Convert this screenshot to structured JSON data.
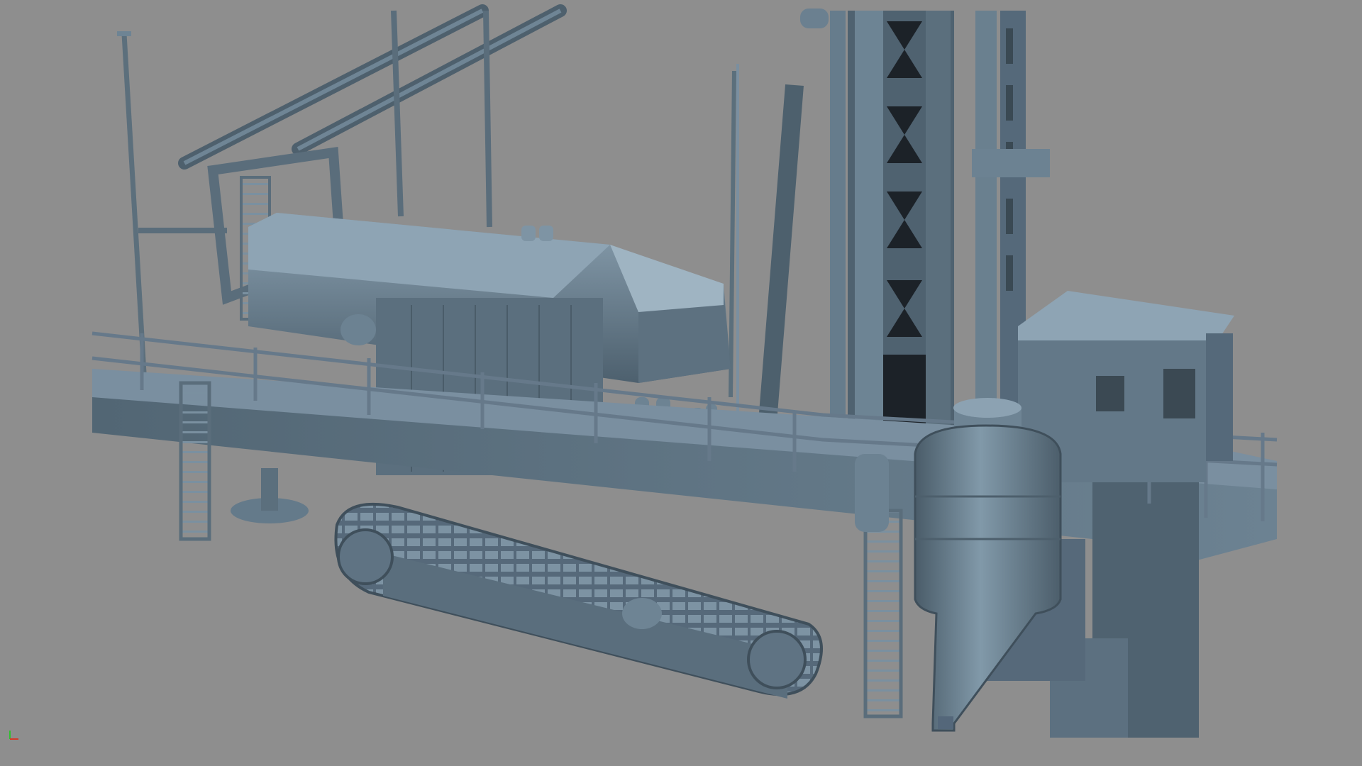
{
  "viewport": {
    "background_color": "#8e8e8e",
    "model_base_color": "#5f7484",
    "model_highlight_color": "#8aa0b0",
    "model_shadow_color": "#3f4f5b",
    "subject": "drilling-rig-3d-model",
    "shading": "solid-clay"
  },
  "axis_gizmo": {
    "icon": "axis-triad-icon",
    "y_axis_color": "#2fc12f",
    "x_axis_color": "#d23a2a"
  }
}
